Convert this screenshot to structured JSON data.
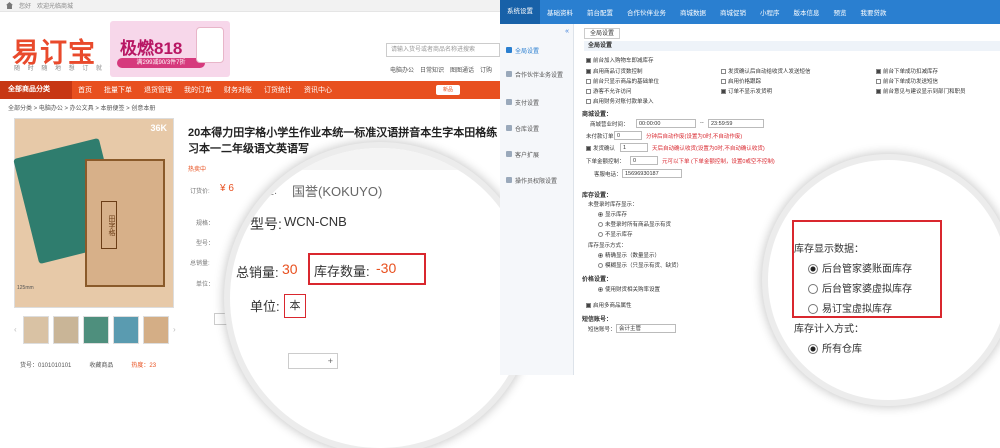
{
  "left": {
    "topbar": {
      "items": [
        "您好",
        "欢迎光临商城"
      ]
    },
    "logo": {
      "text": "易订宝",
      "slogan": "随 时 随 地 想 订 就 订"
    },
    "banner": {
      "title": "极燃818",
      "sub": "满299减90/3件7折"
    },
    "search": {
      "placeholder": "请输入货号或者商品名称进搜索"
    },
    "links": [
      "电脑办公",
      "日常知识",
      "图图通话",
      "订购"
    ],
    "nav": {
      "all": "全部商品分类",
      "items": [
        "首页",
        "批量下单",
        "退货管理",
        "我的订单",
        "财务对账",
        "订货统计",
        "资讯中心"
      ],
      "new": "新品"
    },
    "breadcrumb": "全部分类 > 电脑办公 > 办公文具 > 本册便签 > 创意本册",
    "image": {
      "tag": "36K",
      "cover": "田字格",
      "dim": "125mm"
    },
    "product": {
      "title": "20本得力田字格小学生作业本统一标准汉语拼音本生字本田格练习本一二年级语文英语写",
      "hot": "热卖中",
      "price_label": "订货价:",
      "price": "¥ 6",
      "spec_label": "规格：",
      "model_label": "型号：",
      "sold_label": "总销量:",
      "unit_label": "单位："
    },
    "qty": "1",
    "bottom": {
      "sku": "货号：0101010101",
      "fav": "收藏商品",
      "hot": "热度：23"
    },
    "magnifier": {
      "brand_label": "单位:",
      "brand": "国誉(KOKUYO)",
      "model_label": "型号:",
      "model": "WCN-CNB",
      "sold_label": "总销量:",
      "sold": "30",
      "stock_label": "库存数量:",
      "stock": "-30",
      "unit_label": "单位:",
      "unit": "本",
      "stepper": "+"
    }
  },
  "right": {
    "topnav": [
      "系统设置",
      "基础资料",
      "前台配置",
      "合作伙伴业务",
      "商城数据",
      "商城促销",
      "小程序",
      "版本信息",
      "预览",
      "我要贷款"
    ],
    "sidebar": {
      "collapse": "«",
      "items": [
        "全局设置",
        "合作伙伴业务设置",
        "支付设置",
        "仓库设置",
        "客户扩展",
        "操作员权限设置"
      ]
    },
    "tab": "全局设置",
    "subheader": "全局设置",
    "checks_row1": [
      {
        "label": "前台加入购物车即减库存",
        "on": true
      }
    ],
    "checks_grid": [
      {
        "label": "启用商品订货数控制",
        "on": true
      },
      {
        "label": "发货确认后自动给收货人发送短信",
        "on": false
      },
      {
        "label": "前台下单成功扣减库存",
        "on": true
      },
      {
        "label": "前台只显示商品的基础单位",
        "on": false
      },
      {
        "label": "启用价格跟踪",
        "on": false
      },
      {
        "label": "前台下单成功发送短信",
        "on": false
      },
      {
        "label": "游客不允许访问",
        "on": false
      },
      {
        "label": "订单不显示发货明",
        "on": true
      },
      {
        "label": "前台意见与建议显示到部门和职员",
        "on": true
      },
      {
        "label": "启用财务对账付款单录入",
        "on": false
      }
    ],
    "mall": {
      "title": "商城设置：",
      "biz_time_label": "商城营业时间：",
      "biz_time_from": "00:00:00",
      "biz_time_to": "23:59:59",
      "unpaid_label": "未付款订单",
      "unpaid_val": "0",
      "unpaid_note": "分钟后自动作废(设置为0时,不自动作废)",
      "ship_label": "发货确认",
      "ship_val": "1",
      "ship_note": "天后自动确认收货(设置为0时,不自动确认收货)",
      "min_order_label": "下单金额控制：",
      "min_order_val": "0",
      "min_order_note": "元可以下单 (下单金额控制，设置0或空不控制)",
      "phone_label": "客服电话：",
      "phone": "15696930187"
    },
    "stock": {
      "title": "库存设置：",
      "unlogged_label": "未登录时库存显示：",
      "unlogged_opts": [
        "显示库存",
        "未登录时所有商品显示有货",
        "不显示库存"
      ],
      "mode_label": "库存显示方式：",
      "mode_opts": [
        "精确显示（数量显示）",
        "模糊显示（只显示有货、缺货）"
      ]
    },
    "price": {
      "title": "价格设置：",
      "opt": "使用财货相关购率设置"
    },
    "multi": {
      "label": "启用多商品属性"
    },
    "sms": {
      "title": "短信账号：",
      "label": "短信账号：",
      "val": "会计主管"
    },
    "magnifier": {
      "title": "库存显示数据：",
      "opts": [
        "后台管家婆账面库存",
        "后台管家婆虚拟库存",
        "易订宝虚拟库存"
      ],
      "calc_label": "库存计入方式：",
      "calc_opt": "所有仓库"
    }
  }
}
